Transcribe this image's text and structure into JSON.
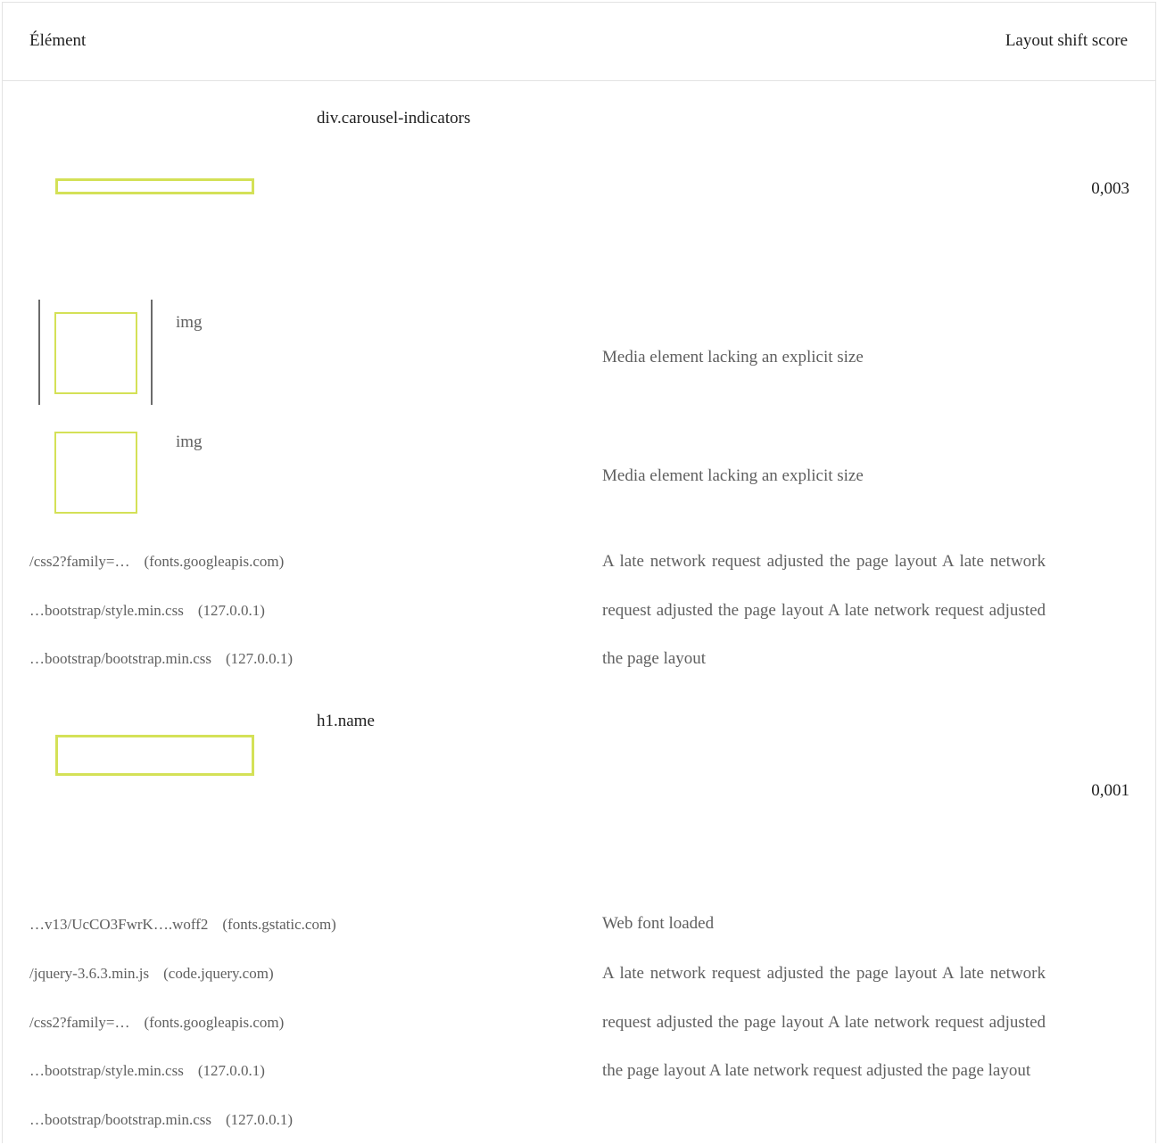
{
  "table": {
    "columns": {
      "element": "Élément",
      "score": "Layout shift score"
    }
  },
  "shifts": [
    {
      "selector": "div.carousel-indicators",
      "score": "0,003",
      "media": [
        {
          "label": "img",
          "reason": "Media element lacking an explicit size"
        },
        {
          "label": "img",
          "reason": "Media element lacking an explicit size"
        }
      ],
      "requests": [
        {
          "url": "/css2?family=…",
          "origin": "(fonts.googleapis.com)"
        },
        {
          "url": "…bootstrap/style.min.css",
          "origin": "(127.0.0.1)"
        },
        {
          "url": "…bootstrap/bootstrap.min.css",
          "origin": "(127.0.0.1)"
        }
      ],
      "requests_reason": "A late network request adjusted the page layout A late network request adjusted the page layout A late network request adjusted the page layout"
    },
    {
      "selector": "h1.name",
      "score": "0,001",
      "font": {
        "url": "…v13/UcCO3FwrK….woff2",
        "origin": "(fonts.gstatic.com)",
        "reason": "Web font loaded"
      },
      "requests": [
        {
          "url": "/jquery-3.6.3.min.js",
          "origin": "(code.jquery.com)"
        },
        {
          "url": "/css2?family=…",
          "origin": "(fonts.googleapis.com)"
        },
        {
          "url": "…bootstrap/style.min.css",
          "origin": "(127.0.0.1)"
        },
        {
          "url": "…bootstrap/bootstrap.min.css",
          "origin": "(127.0.0.1)"
        }
      ],
      "requests_reason": "A late network request adjusted the page layout A late network request adjusted the page layout A late network request adjusted the page layout A late network request adjusted the page layout"
    }
  ],
  "colors": {
    "highlight": "#d4e157",
    "text": "#1f1f1f",
    "muted": "#5f5f5f",
    "border": "#e3e3e3"
  }
}
